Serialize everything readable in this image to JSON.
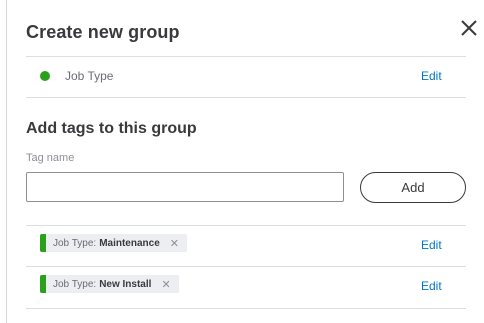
{
  "dialog": {
    "title": "Create new group",
    "close_icon": "close-icon"
  },
  "group": {
    "name": "Job Type",
    "color": "#2ca01c",
    "edit_label": "Edit"
  },
  "add_tags": {
    "heading": "Add tags to this group",
    "field_label": "Tag name",
    "input_value": "",
    "add_label": "Add"
  },
  "tags": [
    {
      "prefix": "Job Type:",
      "name": "Maintenance",
      "remove_icon": "remove-icon",
      "edit_label": "Edit"
    },
    {
      "prefix": "Job Type:",
      "name": "New Install",
      "remove_icon": "remove-icon",
      "edit_label": "Edit"
    }
  ],
  "colors": {
    "accent_green": "#2ca01c",
    "link_blue": "#0077c5"
  }
}
